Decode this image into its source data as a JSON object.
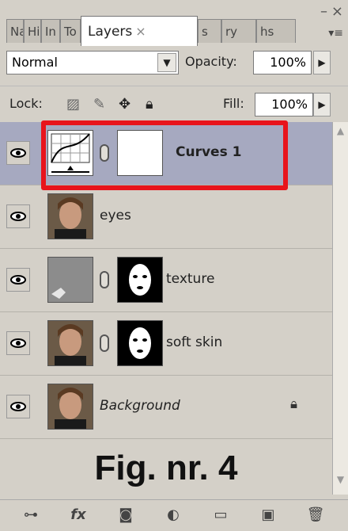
{
  "tabs": [
    {
      "label": "Na"
    },
    {
      "label": "Hi"
    },
    {
      "label": "In"
    },
    {
      "label": "To"
    },
    {
      "label": "Layers",
      "close": "×"
    },
    {
      "label": "s"
    },
    {
      "label": "ry"
    },
    {
      "label": "hs"
    }
  ],
  "window": {
    "minimize": "–",
    "close": "×",
    "menu": "▾≡"
  },
  "blend_mode": {
    "value": "Normal"
  },
  "opacity": {
    "label": "Opacity:",
    "value": "100%"
  },
  "lock": {
    "label": "Lock:"
  },
  "fill": {
    "label": "Fill:",
    "value": "100%"
  },
  "layers": [
    {
      "name": "Curves 1",
      "selected": true
    },
    {
      "name": "eyes"
    },
    {
      "name": "texture"
    },
    {
      "name": "soft skin"
    },
    {
      "name": "Background",
      "locked": true
    }
  ],
  "caption": "Fig. nr. 4",
  "colors": {
    "highlight": "#e8141c",
    "selected_row": "#a6a9c0",
    "panel": "#d4d0c8"
  }
}
